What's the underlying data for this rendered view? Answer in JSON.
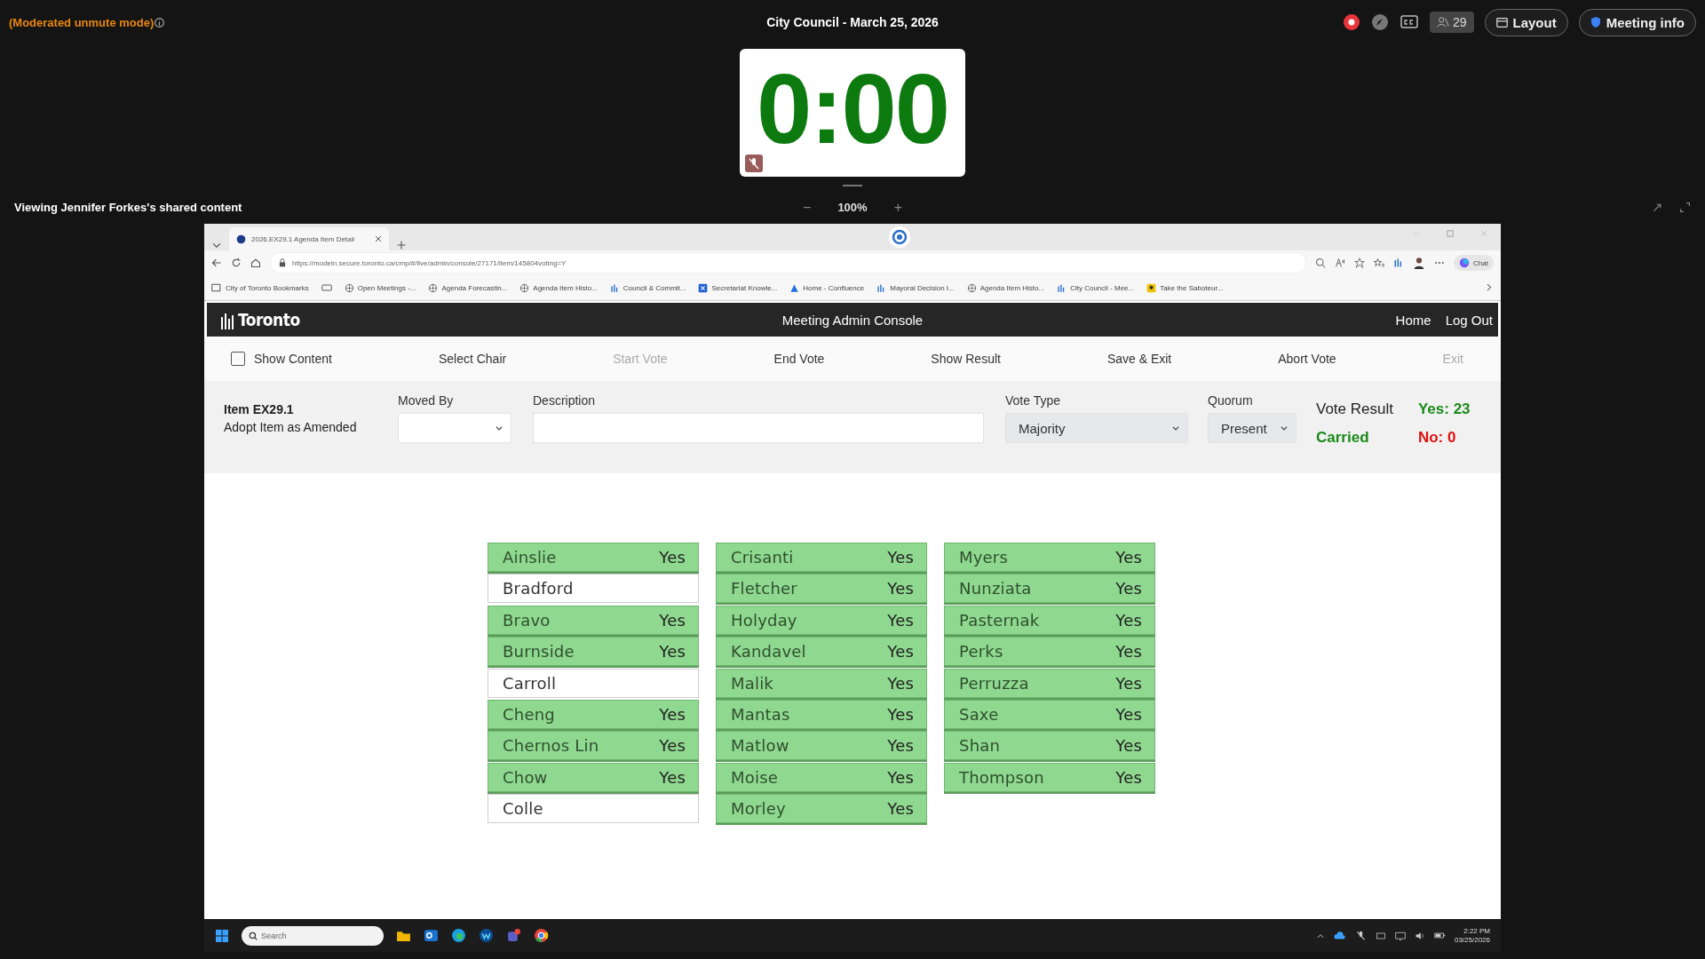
{
  "meeting_bar": {
    "mode_label": "(Moderated unmute mode)",
    "title": "City Council - March 25, 2026",
    "participants": "29",
    "layout_button": "Layout",
    "info_button": "Meeting info",
    "recording": true
  },
  "timer": {
    "value": "0:00"
  },
  "share_bar": {
    "viewing": "Viewing Jennifer Forkes's shared content",
    "zoom": "100%",
    "zoom_out": "−",
    "zoom_in": "+"
  },
  "browser": {
    "tab_title": "2026.EX29.1 Agenda Item Detail",
    "url": "https://modeln.secure.toronto.ca/cmp/#/live/admin/console/27171/item/145804voting=Y",
    "chat_button": "Chat",
    "bookmarks": [
      {
        "label": "City of Toronto Bookmarks",
        "kind": "folder"
      },
      {
        "kind": "card"
      },
      {
        "label": "Open Meetings -...",
        "kind": "globe"
      },
      {
        "label": "Agenda Forecastin...",
        "kind": "globe"
      },
      {
        "label": "Agenda Item Histo...",
        "kind": "globe"
      },
      {
        "label": "Council & Commit...",
        "kind": "chart"
      },
      {
        "label": "Secretariat Knowle...",
        "kind": "app"
      },
      {
        "label": "Home - Confluence",
        "kind": "confluence"
      },
      {
        "label": "Mayoral Decision I...",
        "kind": "chart"
      },
      {
        "label": "Agenda Item Histo...",
        "kind": "globe"
      },
      {
        "label": "City Council - Mee...",
        "kind": "chart"
      },
      {
        "label": "Take the Saboteur...",
        "kind": "yellow"
      }
    ]
  },
  "console": {
    "logo": "Toronto",
    "title": "Meeting Admin Console",
    "nav": [
      "Home",
      "Log Out"
    ],
    "show_content": {
      "label": "Show Content",
      "checked": false
    },
    "actions": [
      {
        "label": "Select Chair",
        "disabled": false
      },
      {
        "label": "Start Vote",
        "disabled": true
      },
      {
        "label": "End Vote",
        "disabled": false
      },
      {
        "label": "Show Result",
        "disabled": false
      },
      {
        "label": "Save & Exit",
        "disabled": false
      },
      {
        "label": "Abort Vote",
        "disabled": false
      },
      {
        "label": "Exit",
        "disabled": true
      }
    ],
    "item": {
      "number": "Item EX29.1",
      "motion": "Adopt Item as Amended"
    },
    "moved_by": {
      "label": "Moved By"
    },
    "description": {
      "label": "Description"
    },
    "vote_type": {
      "label": "Vote Type",
      "value": "Majority"
    },
    "quorum": {
      "label": "Quorum",
      "value": "Present"
    },
    "result": {
      "label": "Vote Result",
      "outcome": "Carried",
      "yes": "Yes: 23",
      "no": "No: 0"
    }
  },
  "members": [
    [
      {
        "name": "Ainslie",
        "vote": "Yes",
        "voted": true
      },
      {
        "name": "Bradford",
        "voted": false
      },
      {
        "name": "Bravo",
        "vote": "Yes",
        "voted": true
      },
      {
        "name": "Burnside",
        "vote": "Yes",
        "voted": true
      },
      {
        "name": "Carroll",
        "voted": false
      },
      {
        "name": "Cheng",
        "vote": "Yes",
        "voted": true
      },
      {
        "name": "Chernos Lin",
        "vote": "Yes",
        "voted": true
      },
      {
        "name": "Chow",
        "vote": "Yes",
        "voted": true
      },
      {
        "name": "Colle",
        "voted": false
      }
    ],
    [
      {
        "name": "Crisanti",
        "vote": "Yes",
        "voted": true
      },
      {
        "name": "Fletcher",
        "vote": "Yes",
        "voted": true
      },
      {
        "name": "Holyday",
        "vote": "Yes",
        "voted": true
      },
      {
        "name": "Kandavel",
        "vote": "Yes",
        "voted": true
      },
      {
        "name": "Malik",
        "vote": "Yes",
        "voted": true
      },
      {
        "name": "Mantas",
        "vote": "Yes",
        "voted": true
      },
      {
        "name": "Matlow",
        "vote": "Yes",
        "voted": true
      },
      {
        "name": "Moise",
        "vote": "Yes",
        "voted": true
      },
      {
        "name": "Morley",
        "vote": "Yes",
        "voted": true
      }
    ],
    [
      {
        "name": "Myers",
        "vote": "Yes",
        "voted": true
      },
      {
        "name": "Nunziata",
        "vote": "Yes",
        "voted": true
      },
      {
        "name": "Pasternak",
        "vote": "Yes",
        "voted": true
      },
      {
        "name": "Perks",
        "vote": "Yes",
        "voted": true
      },
      {
        "name": "Perruzza",
        "vote": "Yes",
        "voted": true
      },
      {
        "name": "Saxe",
        "vote": "Yes",
        "voted": true
      },
      {
        "name": "Shan",
        "vote": "Yes",
        "voted": true
      },
      {
        "name": "Thompson",
        "vote": "Yes",
        "voted": true
      }
    ]
  ],
  "taskbar": {
    "search_placeholder": "Search",
    "time": "2:22 PM",
    "date": "03/25/2026"
  }
}
